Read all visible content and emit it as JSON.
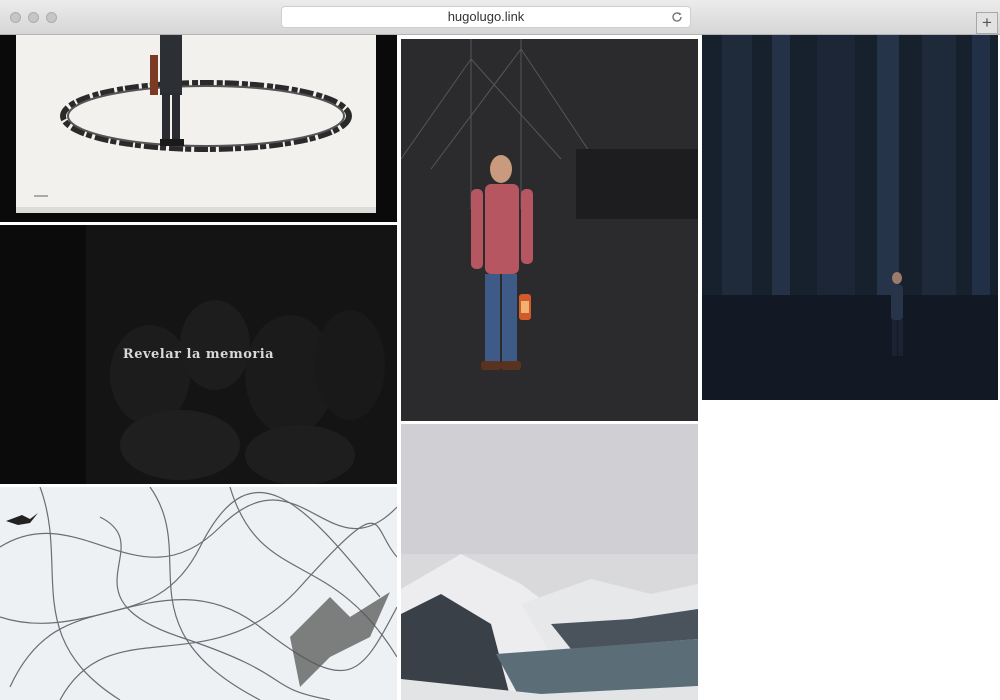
{
  "browser": {
    "url": "hugolugo.link",
    "new_tab_symbol": "+",
    "traffic_light_color": "#c6c6c6"
  },
  "gallery": {
    "tiles": [
      {
        "subject": "man standing in drawn circle on paper",
        "caption": ""
      },
      {
        "subject": "dark group portrait",
        "caption": "Revelar la memoria"
      },
      {
        "subject": "scribbled lines with birds",
        "caption": ""
      },
      {
        "subject": "man with red shirt holding lantern before ship",
        "caption": ""
      },
      {
        "subject": "snowy mountains and lake landscape",
        "caption": ""
      },
      {
        "subject": "man standing in dark forest",
        "caption": ""
      }
    ]
  }
}
